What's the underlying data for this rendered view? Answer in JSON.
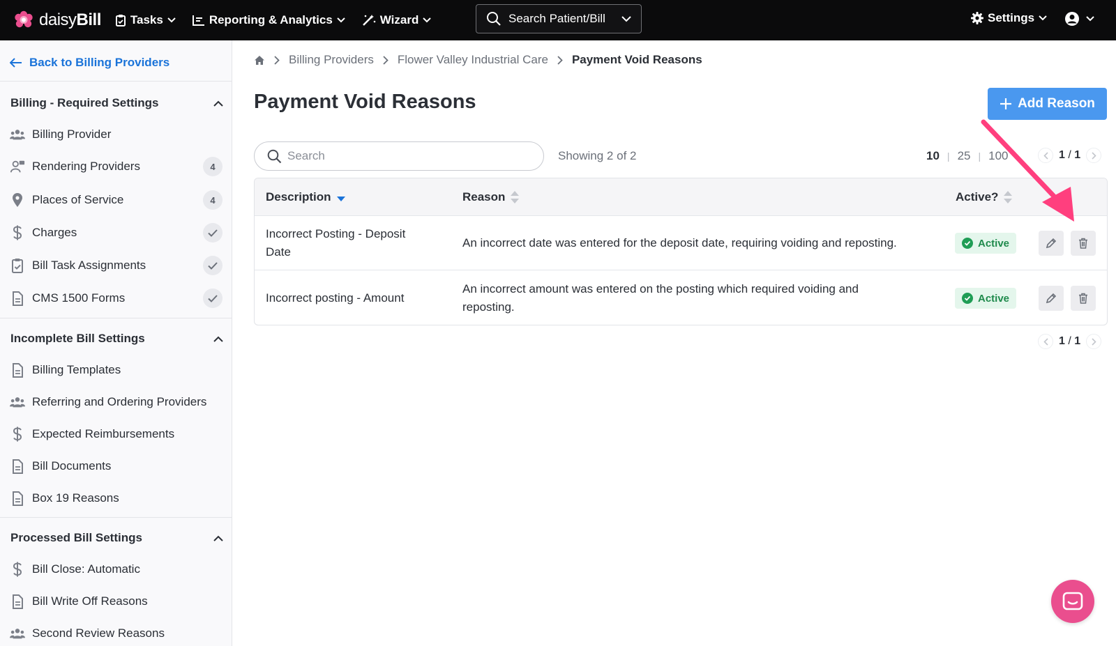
{
  "app": {
    "brand": "daisyBill",
    "brand_prefix": "daisy",
    "brand_suffix": "Bill",
    "accent": "#4a98ef",
    "brand_pink": "#ea4e8e"
  },
  "topnav": {
    "tasks": "Tasks",
    "reporting": "Reporting & Analytics",
    "wizard": "Wizard",
    "search_label": "Search Patient/Bill",
    "settings": "Settings"
  },
  "sidebar": {
    "back_label": "Back to Billing Providers",
    "sections": [
      {
        "title": "Billing - Required Settings",
        "items": [
          {
            "label": "Billing Provider",
            "icon": "users-icon"
          },
          {
            "label": "Rendering Providers",
            "icon": "provider-icon",
            "count": "4"
          },
          {
            "label": "Places of Service",
            "icon": "map-pin-icon",
            "count": "4"
          },
          {
            "label": "Charges",
            "icon": "dollar-icon",
            "check": true
          },
          {
            "label": "Bill Task Assignments",
            "icon": "clipboard-check-icon",
            "check": true
          },
          {
            "label": "CMS 1500 Forms",
            "icon": "document-icon",
            "check": true
          }
        ]
      },
      {
        "title": "Incomplete Bill Settings",
        "items": [
          {
            "label": "Billing Templates",
            "icon": "document-icon"
          },
          {
            "label": "Referring and Ordering Providers",
            "icon": "users-icon"
          },
          {
            "label": "Expected Reimbursements",
            "icon": "dollar-icon"
          },
          {
            "label": "Bill Documents",
            "icon": "document-icon"
          },
          {
            "label": "Box 19 Reasons",
            "icon": "document-icon"
          }
        ]
      },
      {
        "title": "Processed Bill Settings",
        "items": [
          {
            "label": "Bill Close: Automatic",
            "icon": "dollar-icon"
          },
          {
            "label": "Bill Write Off Reasons",
            "icon": "document-icon"
          },
          {
            "label": "Second Review Reasons",
            "icon": "users-icon"
          }
        ]
      }
    ]
  },
  "breadcrumb": {
    "items": [
      "Billing Providers",
      "Flower Valley Industrial Care"
    ],
    "current": "Payment Void Reasons"
  },
  "page": {
    "title": "Payment Void Reasons",
    "add_button": "Add Reason"
  },
  "toolbar": {
    "search_placeholder": "Search",
    "showing": "Showing 2 of 2",
    "per_page_options": [
      "10",
      "25",
      "100"
    ],
    "per_page_selected": "10",
    "page_current": "1",
    "page_total": "1"
  },
  "table": {
    "columns": {
      "description": "Description",
      "reason": "Reason",
      "active": "Active?"
    },
    "rows": [
      {
        "description_line1": "Incorrect Posting - Deposit",
        "description_line2": "Date",
        "reason_line1": "An incorrect date was entered for the deposit date, requiring voiding and reposting.",
        "reason_line2": "",
        "status": "Active"
      },
      {
        "description_line1": "Incorrect posting - Amount",
        "description_line2": "",
        "reason_line1": "An incorrect amount was entered on the posting which required voiding and",
        "reason_line2": "reposting.",
        "status": "Active"
      }
    ]
  },
  "annotation": {
    "arrow_color": "#ff3f7e",
    "points_to": "delete-button"
  }
}
